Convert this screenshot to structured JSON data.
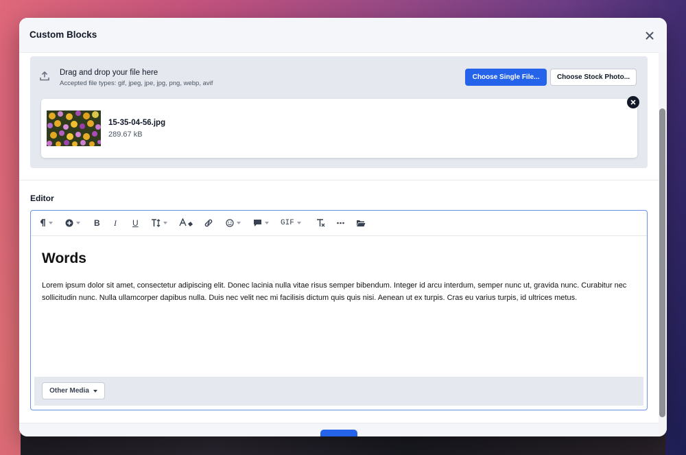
{
  "modal": {
    "title": "Custom Blocks",
    "close_icon": "close-icon"
  },
  "upload": {
    "title": "Drag and drop your file here",
    "accepted": "Accepted file types: gif, jpeg, jpe, jpg, png, webp, avif",
    "choose_single": "Choose Single File...",
    "choose_stock": "Choose Stock Photo...",
    "icon": "upload-icon"
  },
  "file": {
    "name": "15-35-04-56.jpg",
    "size": "289.67 kB",
    "remove_icon": "close-icon"
  },
  "editor": {
    "label": "Editor",
    "toolbar": [
      {
        "name": "paragraph-format",
        "icon": "pilcrow-icon",
        "dropdown": true
      },
      {
        "name": "insert",
        "icon": "plus-circle-icon",
        "dropdown": true
      },
      {
        "name": "bold",
        "icon": "bold-icon",
        "dropdown": false
      },
      {
        "name": "italic",
        "icon": "italic-icon",
        "dropdown": false
      },
      {
        "name": "underline",
        "icon": "underline-icon",
        "dropdown": false
      },
      {
        "name": "font-size",
        "icon": "text-height-icon",
        "dropdown": true
      },
      {
        "name": "text-color",
        "icon": "text-color-icon",
        "dropdown": false
      },
      {
        "name": "link",
        "icon": "link-icon",
        "dropdown": false
      },
      {
        "name": "emoji",
        "icon": "smile-icon",
        "dropdown": true
      },
      {
        "name": "comment",
        "icon": "comment-icon",
        "dropdown": true
      },
      {
        "name": "gif",
        "icon": "gif-icon",
        "label": "GIF",
        "dropdown": true
      },
      {
        "name": "clear-format",
        "icon": "clear-format-icon",
        "dropdown": false
      },
      {
        "name": "more",
        "icon": "ellipsis-icon",
        "dropdown": false
      },
      {
        "name": "media-folder",
        "icon": "folder-open-icon",
        "dropdown": false
      }
    ],
    "content": {
      "heading": "Words",
      "paragraph": "Lorem ipsum dolor sit amet, consectetur adipiscing elit. Donec lacinia nulla vitae risus semper bibendum. Integer id arcu interdum, semper nunc ut, gravida nunc. Curabitur nec sollicitudin nunc. Nulla ullamcorper dapibus nulla. Duis nec velit nec mi facilisis dictum quis quis nisi. Aenean ut ex turpis. Cras eu varius turpis, id ultrices metus."
    },
    "other_media": "Other Media"
  },
  "colors": {
    "primary": "#2563eb",
    "panel": "#e5e8ef",
    "text": "#111827"
  }
}
